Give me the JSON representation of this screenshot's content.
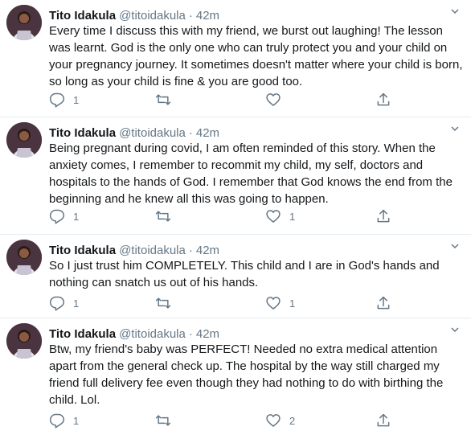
{
  "tweets": [
    {
      "name": "Tito Idakula",
      "handle": "@titoidakula",
      "time": "42m",
      "text": "Every time I discuss this with my friend, we burst out laughing! The lesson was learnt. God is the only one who can truly protect you and your child on your pregnancy journey. It sometimes doesn't matter where your child is born, so long as your child is fine & you are good too.",
      "reply_count": "1",
      "retweet_count": "",
      "like_count": ""
    },
    {
      "name": "Tito Idakula",
      "handle": "@titoidakula",
      "time": "42m",
      "text": "Being pregnant during covid, I am often reminded of this story. When the anxiety comes, I remember to recommit my child, my self, doctors and hospitals to the hands of God. I remember that God knows the end from the beginning and he knew all this was going to happen.",
      "reply_count": "1",
      "retweet_count": "",
      "like_count": "1"
    },
    {
      "name": "Tito Idakula",
      "handle": "@titoidakula",
      "time": "42m",
      "text": "So I just trust him COMPLETELY. This child and I are in God's hands and nothing can snatch us out of his hands.",
      "reply_count": "1",
      "retweet_count": "",
      "like_count": "1"
    },
    {
      "name": "Tito Idakula",
      "handle": "@titoidakula",
      "time": "42m",
      "text": "Btw, my friend's baby was PERFECT! Needed no extra medical attention apart from the general check up. The hospital by the way still charged my friend full delivery fee even though they had nothing to do with birthing the child. Lol.",
      "reply_count": "1",
      "retweet_count": "",
      "like_count": "2"
    }
  ],
  "separator": "·",
  "colors": {
    "text": "#14171a",
    "muted": "#657786",
    "divider": "#e6ecf0"
  },
  "icons": [
    "chevron-down-icon",
    "reply-icon",
    "retweet-icon",
    "like-icon",
    "share-icon",
    "avatar"
  ]
}
